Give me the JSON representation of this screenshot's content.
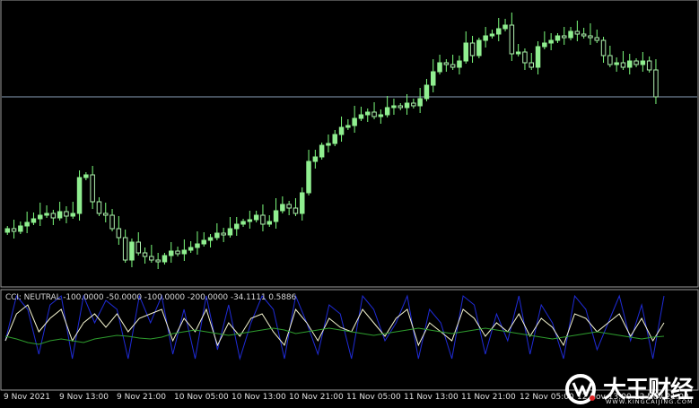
{
  "indicator": {
    "label": "CCI: NEUTRAL -100.0000 -50.0000 -100.0000 -200.0000 -34.1111 0.5886"
  },
  "time_axis": {
    "labels": [
      "9 Nov 2021",
      "9 Nov 13:00",
      "9 Nov 21:00",
      "10 Nov 05:00",
      "10 Nov 13:00",
      "10 Nov 21:00",
      "11 Nov 05:00",
      "11 Nov 13:00",
      "11 Nov 21:00",
      "12 Nov 05:00",
      "12 Nov 13:00",
      "12 Nov 21:00"
    ]
  },
  "watermark": {
    "brand_text": "大王财经",
    "url_text": "WWW.KINGCAIJING.COM"
  },
  "colors": {
    "background": "#000000",
    "candle_up": "#90ee90",
    "candle_down": "#b0f0b0",
    "wick": "#7cfc7c",
    "hline": "#8aa0b8",
    "cci_blue": "#1f2bd6",
    "cci_white": "#f5f5d0",
    "cci_green": "#2e9d2e",
    "border": "#9a9a9a"
  },
  "chart_data": {
    "type": "candlestick",
    "price_closes": [
      255,
      258,
      252,
      248,
      244,
      240,
      238,
      243,
      236,
      241,
      238,
      198,
      195,
      225,
      238,
      240,
      255,
      265,
      290,
      270,
      282,
      286,
      290,
      292,
      285,
      280,
      283,
      279,
      276,
      272,
      268,
      265,
      260,
      262,
      255,
      250,
      247,
      245,
      240,
      250,
      247,
      235,
      228,
      232,
      238,
      215,
      180,
      175,
      162,
      160,
      150,
      142,
      140,
      132,
      128,
      125,
      130,
      128,
      120,
      118,
      120,
      115,
      118,
      110,
      95,
      80,
      70,
      72,
      75,
      68,
      48,
      62,
      45,
      40,
      38,
      32,
      28,
      60,
      58,
      70,
      75,
      52,
      48,
      45,
      40,
      42,
      35,
      38,
      40,
      42,
      45,
      62,
      72,
      70,
      75,
      68,
      72,
      68,
      78,
      108
    ],
    "cci_series": [
      {
        "name": "blue",
        "values": [
          380,
          330,
          345,
          395,
          340,
          330,
          400,
          330,
          360,
          335,
          345,
          400,
          330,
          360,
          330,
          395,
          345,
          400,
          330,
          390,
          340,
          400,
          360,
          330,
          345,
          400,
          330,
          360,
          395,
          340,
          350,
          400,
          330,
          345,
          380,
          360,
          330,
          400,
          345,
          360,
          400,
          330,
          340,
          395,
          350,
          380,
          330,
          395,
          340,
          360,
          400,
          330,
          345,
          390,
          360,
          330,
          380,
          340,
          400,
          330
        ]
      },
      {
        "name": "white",
        "values": [
          380,
          350,
          340,
          370,
          355,
          345,
          380,
          360,
          350,
          365,
          350,
          370,
          355,
          350,
          345,
          380,
          355,
          370,
          345,
          385,
          360,
          375,
          355,
          350,
          370,
          385,
          345,
          360,
          380,
          355,
          365,
          370,
          345,
          360,
          375,
          355,
          345,
          385,
          360,
          370,
          380,
          345,
          355,
          375,
          360,
          370,
          350,
          375,
          355,
          365,
          385,
          350,
          355,
          370,
          360,
          350,
          375,
          355,
          380,
          360
        ]
      },
      {
        "name": "green",
        "values": [
          375,
          378,
          382,
          384,
          380,
          378,
          380,
          382,
          378,
          376,
          374,
          375,
          377,
          378,
          376,
          372,
          370,
          368,
          370,
          372,
          374,
          372,
          370,
          368,
          366,
          368,
          372,
          370,
          368,
          366,
          368,
          370,
          372,
          374,
          372,
          370,
          368,
          366,
          368,
          370,
          372,
          370,
          368,
          366,
          368,
          370,
          372,
          374,
          376,
          378,
          376,
          374,
          372,
          370,
          372,
          374,
          376,
          378,
          376,
          375
        ]
      }
    ]
  }
}
